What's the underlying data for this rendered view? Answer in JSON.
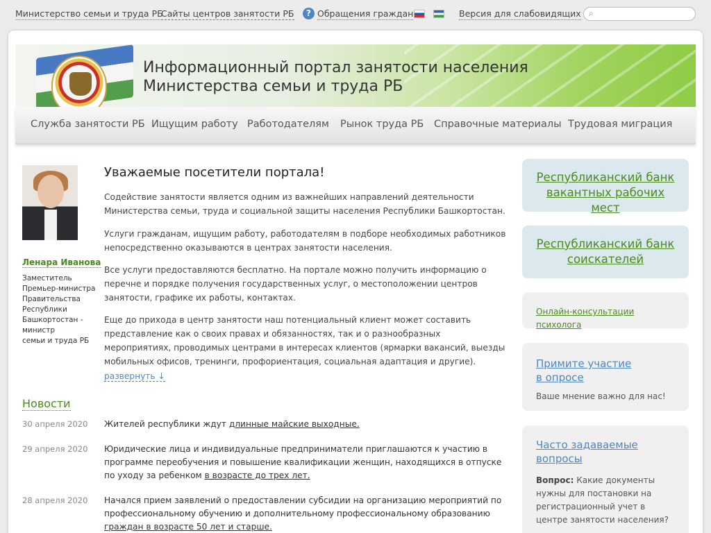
{
  "topbar": {
    "ministry_link": "Министерство семьи и труда РБ",
    "centers_link": "Сайты центров занятости РБ",
    "appeals_icon": "question-icon",
    "appeals_link": "Обращения граждан",
    "accessibility_link": "Версия для слабовидящих",
    "search_placeholder": ""
  },
  "banner": {
    "title_line1": "Информационный портал занятости населения",
    "title_line2": "Министерства семьи и труда РБ"
  },
  "menu": [
    "Служба занятости РБ",
    "Ищущим работу",
    "Работодателям",
    "Рынок труда РБ",
    "Справочные материалы",
    "Трудовая миграция"
  ],
  "person": {
    "name": "Ленара Иванова",
    "title_lines": [
      "Заместитель",
      "Премьер-министра",
      "Правительства",
      "Республики",
      "Башкортостан -",
      "министр",
      "семьи и труда РБ"
    ]
  },
  "main": {
    "welcome": "Уважаемые посетители портала!",
    "paragraphs": [
      "Содействие занятости является одним из важнейших направлений деятельности Министерства семьи, труда и социальной защиты населения Республики Башкортостан.",
      "Услуги гражданам, ищущим работу, работодателям в подборе необходимых работников непосредственно оказываются в центрах занятости населения.",
      "Все услуги предоставляются бесплатно. На портале можно получить информацию о перечне и порядке получения государственных услуг, о местоположении центров занятости, графике их работы, контактах.",
      "Еще до прихода в центр занятости наш потенциальный клиент может составить представление как о своих правах и обязанностях, так и о разнообразных мероприятиях, проводимых центрами в интересах клиентов (ярмарки вакансий, выезды мобильных офисов, тренинги, профориентация, социальная адаптация и другие)."
    ],
    "expand": "развернуть ↓"
  },
  "news": {
    "heading": "Новости",
    "items": [
      {
        "date": "30 апреля 2020",
        "text": "Жителей республики ждут ",
        "link": "длинные майские выходные."
      },
      {
        "date": "29 апреля 2020",
        "text": "Юридические лица и индивидуальные предприниматели приглашаются к участию в программе переобучения и повышение квалификации женщин, находящихся в отпуске по уходу за ребенком ",
        "link": "в возрасте до трех лет."
      },
      {
        "date": "28 апреля 2020",
        "text": "Начался прием заявлений о предоставлении субсидии на организацию мероприятий по профессиональному обучению и дополнительному профессиональному образованию ",
        "link": "граждан в возрасте 50 лет и старше."
      }
    ]
  },
  "sidebar": {
    "vacancies_bank": "Республиканский банк вакантных рабочих мест",
    "applicants_bank": "Республиканский банк соискателей",
    "psych_consult": "Онлайн-консультации психолога",
    "poll_title": "Примите участие в опросе",
    "poll_sub": "Ваше мнение важно для нас!",
    "faq_title": "Часто задаваемые вопросы",
    "faq_q_label": "Вопрос:",
    "faq_q_text": "Какие документы нужны для постановки на регистрационный учет в центре занятости населения?"
  }
}
